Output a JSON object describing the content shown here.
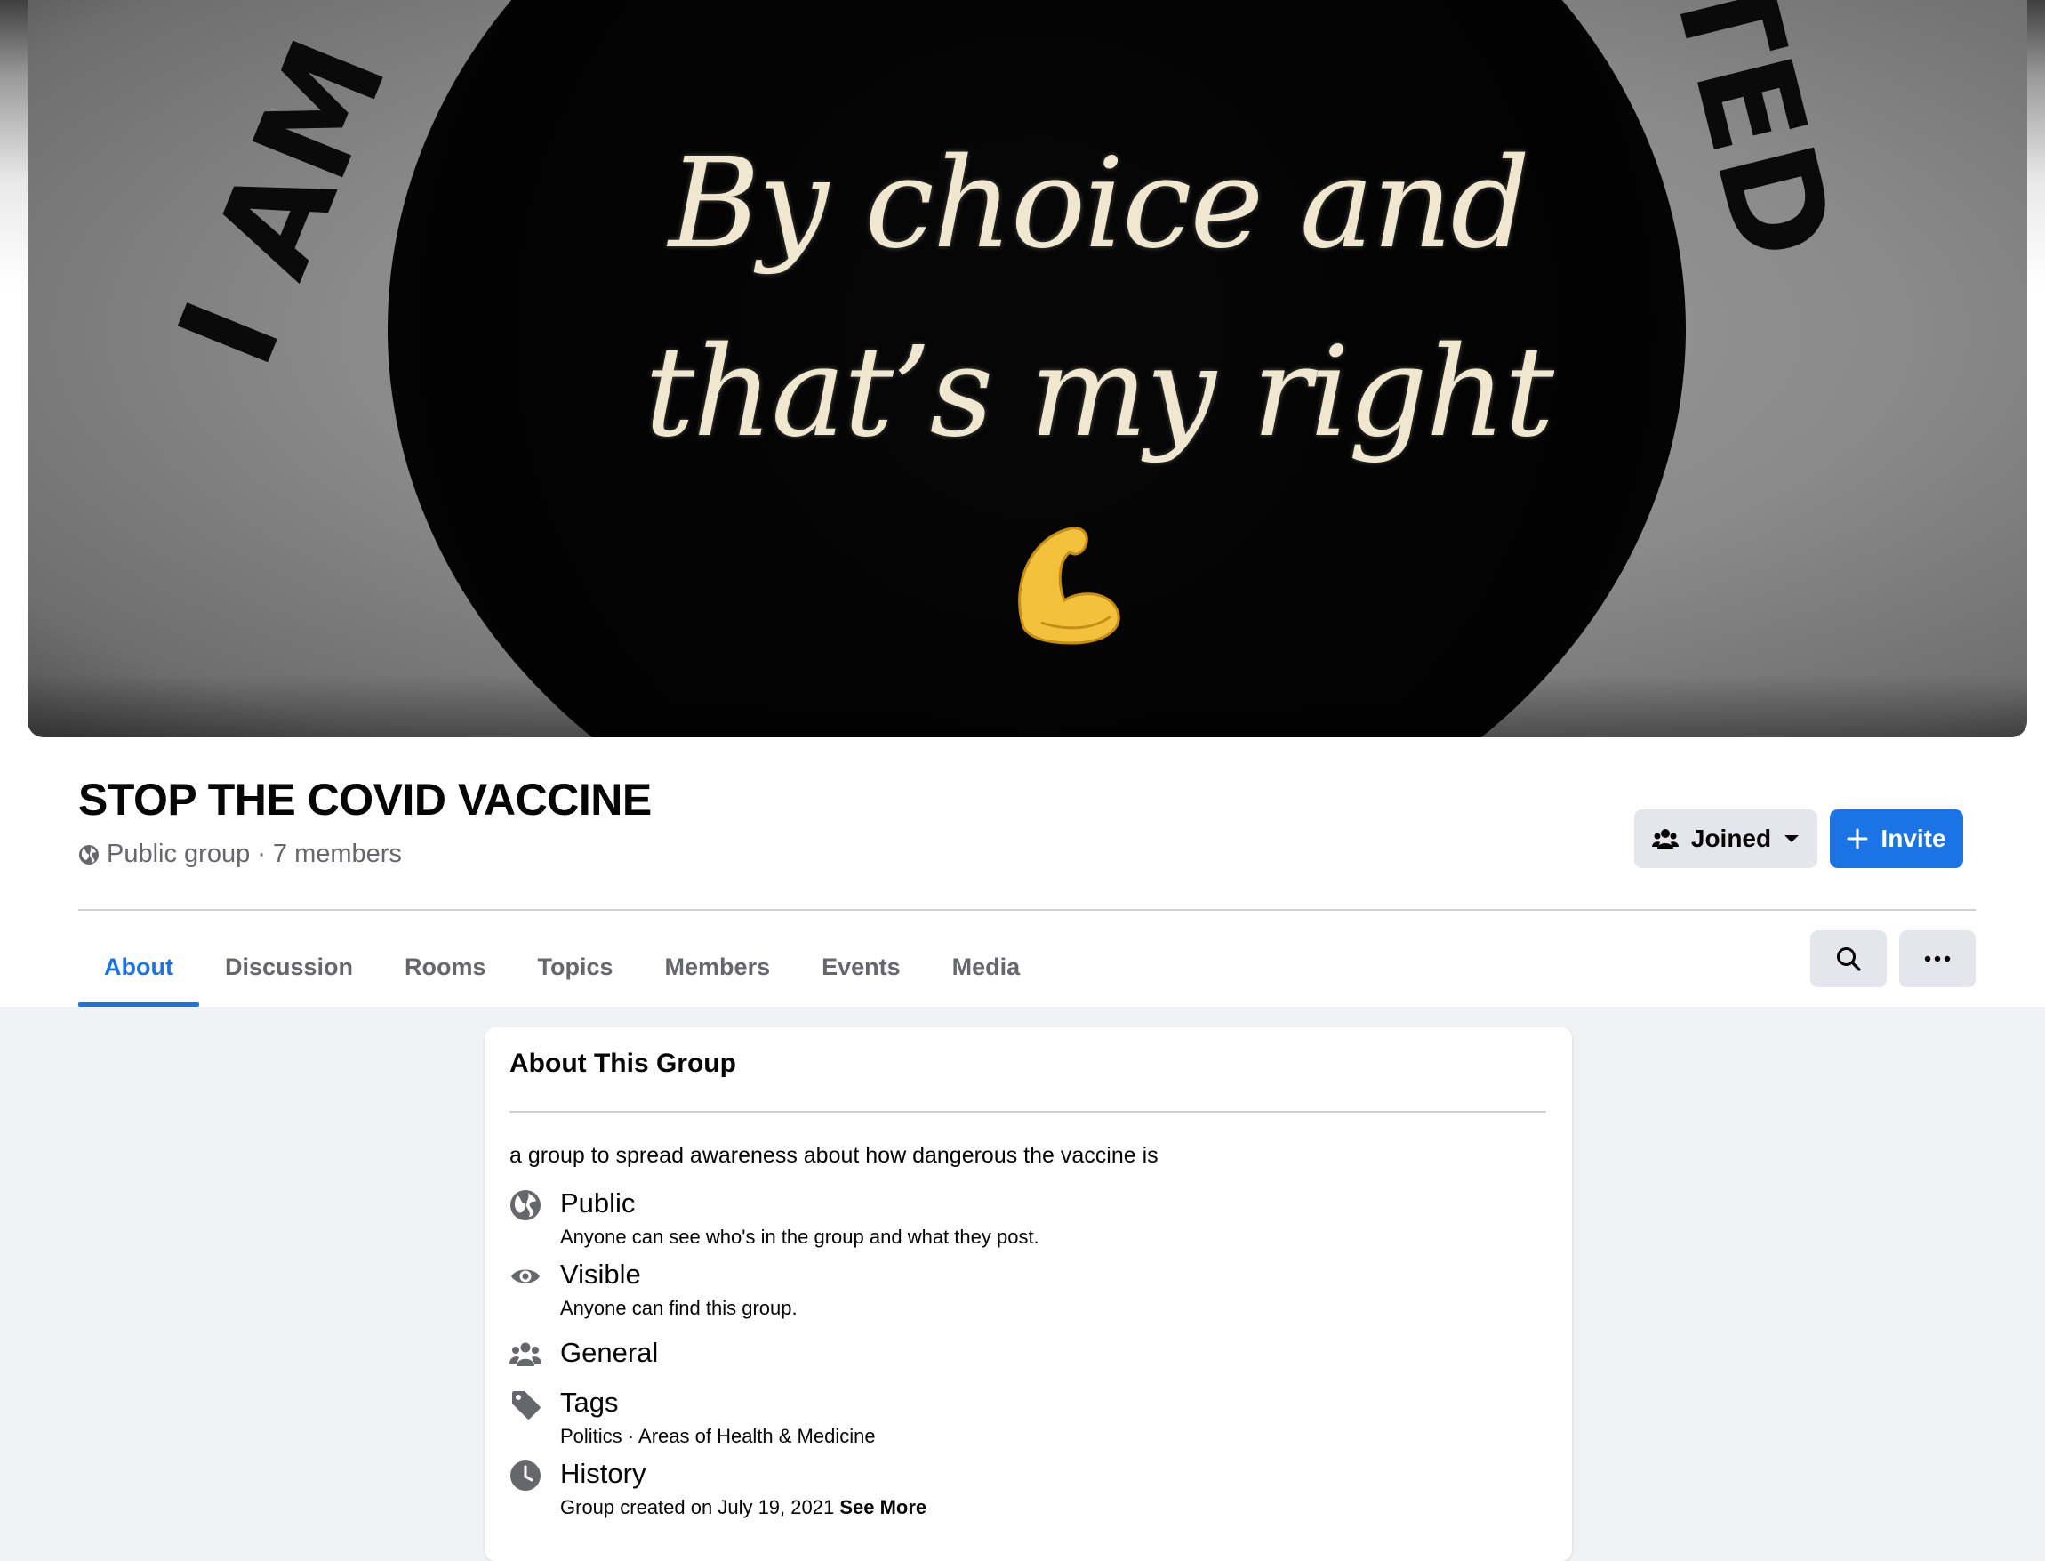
{
  "cover": {
    "line1": "By choice and",
    "line2": "that’s my right",
    "arc_left": "I AM",
    "arc_right": "TED"
  },
  "group": {
    "name": "STOP THE COVID VACCINE",
    "privacy": "Public group",
    "separator": "·",
    "members": "7 members"
  },
  "actions": {
    "joined_label": "Joined",
    "invite_label": "Invite"
  },
  "tabs": [
    {
      "label": "About",
      "active": true
    },
    {
      "label": "Discussion"
    },
    {
      "label": "Rooms"
    },
    {
      "label": "Topics"
    },
    {
      "label": "Members"
    },
    {
      "label": "Events"
    },
    {
      "label": "Media"
    }
  ],
  "about": {
    "title": "About This Group",
    "description": "a group to spread awareness about how dangerous the vaccine is",
    "items": [
      {
        "icon": "globe-icon",
        "title": "Public",
        "subtitle": "Anyone can see who's in the group and what they post."
      },
      {
        "icon": "eye-icon",
        "title": "Visible",
        "subtitle": "Anyone can find this group."
      },
      {
        "icon": "people-icon",
        "title": "General"
      },
      {
        "icon": "tag-icon",
        "title": "Tags",
        "subtitle": "Politics · Areas of Health & Medicine"
      },
      {
        "icon": "clock-icon",
        "title": "History",
        "subtitle": "Group created on July 19, 2021",
        "link": "See More"
      }
    ]
  },
  "colors": {
    "accent": "#1b74e4",
    "secondary_text": "#65676b",
    "background": "#f0f2f5"
  }
}
